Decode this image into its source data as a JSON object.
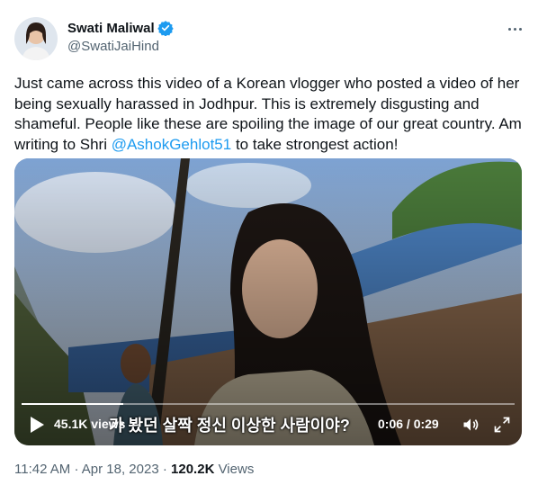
{
  "author": {
    "display_name": "Swati Maliwal",
    "handle": "@SwatiJaiHind",
    "verified": true
  },
  "tweet": {
    "text_before": "Just came across this video of a Korean vlogger who posted a video of her being sexually harassed in Jodhpur. This is extremely disgusting and shameful. People like these are spoiling the image of our great country. Am writing to Shri ",
    "mention": "@AshokGehlot51",
    "text_after": " to take strongest action!"
  },
  "video": {
    "subtitle": "가 봤던 살짝 정신 이상한 사람이야?",
    "views": "45.1K views",
    "time": "0:06 / 0:29",
    "progress": 0.207,
    "icons": {
      "play": "play-icon",
      "volume": "volume-icon",
      "fullscreen": "fullscreen-icon"
    }
  },
  "meta": {
    "time": "11:42 AM",
    "date": "Apr 18, 2023",
    "views_count": "120.2K",
    "views_label": "Views",
    "separator": "·"
  },
  "colors": {
    "link": "#1d9bf0",
    "secondary": "#536471",
    "primary_text": "#0f1419"
  }
}
